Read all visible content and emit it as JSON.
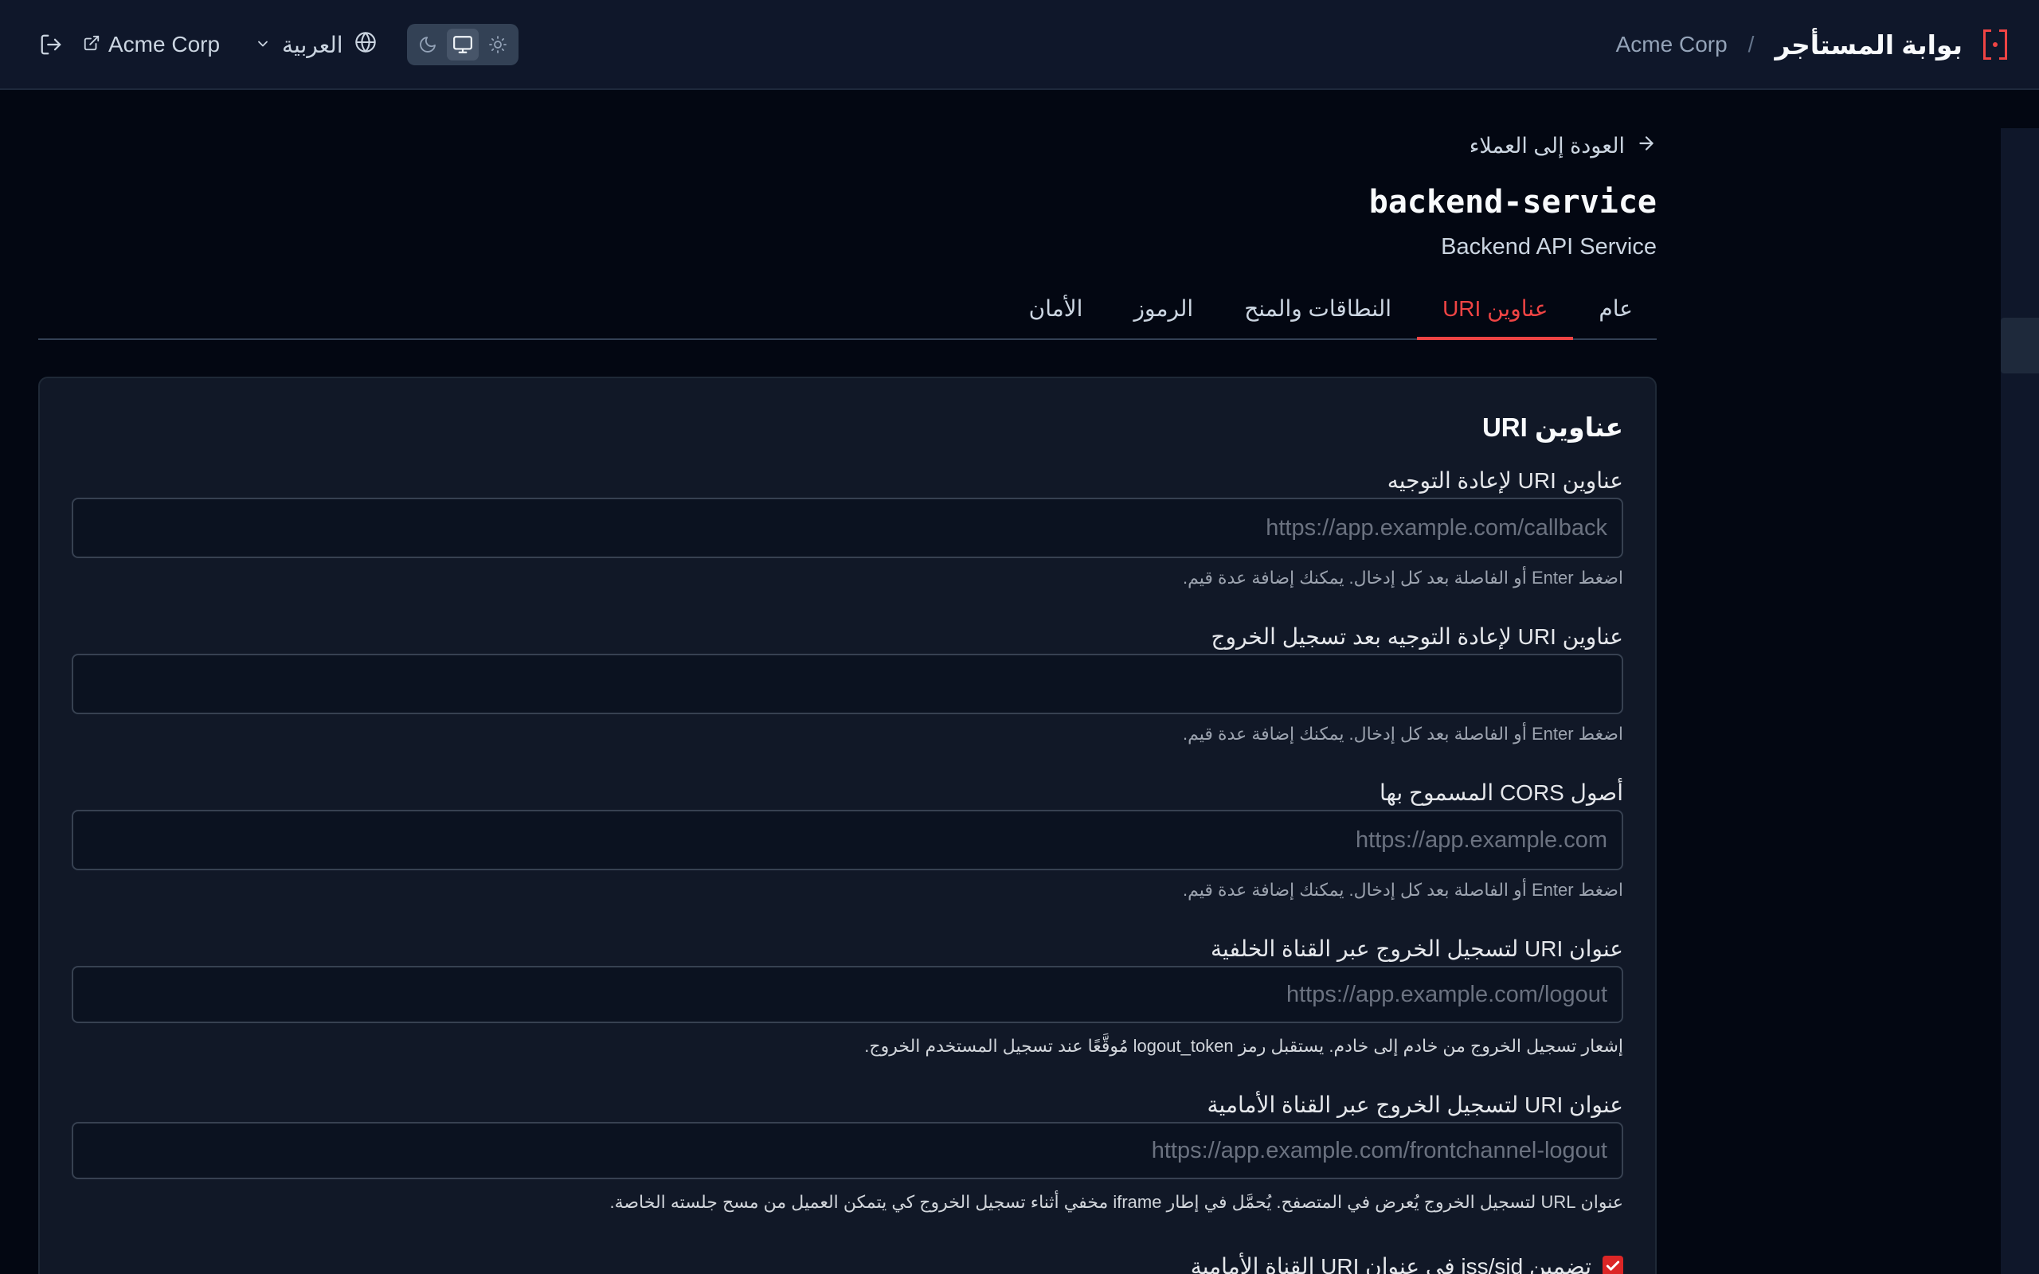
{
  "header": {
    "brand_title": "بوابة المستأجر",
    "separator": "/",
    "tenant": "Acme Corp",
    "tenant_link": "Acme Corp",
    "language": "العربية"
  },
  "back_link": "العودة إلى العملاء",
  "client": {
    "name": "backend-service",
    "description": "Backend API Service"
  },
  "tabs": [
    {
      "label": "عام",
      "active": false
    },
    {
      "label": "عناوين URI",
      "active": true
    },
    {
      "label": "النطاقات والمنح",
      "active": false
    },
    {
      "label": "الرموز",
      "active": false
    },
    {
      "label": "الأمان",
      "active": false
    }
  ],
  "card": {
    "title": "عناوين URI",
    "fields": [
      {
        "label": "عناوين URI لإعادة التوجيه",
        "value": "",
        "placeholder": "https://app.example.com/callback",
        "help": "اضغط Enter أو الفاصلة بعد كل إدخال. يمكنك إضافة عدة قيم."
      },
      {
        "label": "عناوين URI لإعادة التوجيه بعد تسجيل الخروج",
        "value": "",
        "placeholder": "",
        "help": "اضغط Enter أو الفاصلة بعد كل إدخال. يمكنك إضافة عدة قيم."
      },
      {
        "label": "أصول CORS المسموح بها",
        "value": "",
        "placeholder": "https://app.example.com",
        "help": "اضغط Enter أو الفاصلة بعد كل إدخال. يمكنك إضافة عدة قيم."
      },
      {
        "label": "عنوان URI لتسجيل الخروج عبر القناة الخلفية",
        "value": "",
        "placeholder": "https://app.example.com/logout",
        "help": "إشعار تسجيل الخروج من خادم إلى خادم. يستقبل رمز logout_token مُوقَّعًا عند تسجيل المستخدم الخروج."
      },
      {
        "label": "عنوان URI لتسجيل الخروج عبر القناة الأمامية",
        "value": "",
        "placeholder": "https://app.example.com/frontchannel-logout",
        "help": "عنوان URL لتسجيل الخروج يُعرض في المتصفح. يُحمَّل في إطار iframe مخفي أثناء تسجيل الخروج كي يتمكن العميل من مسح جلسته الخاصة."
      }
    ],
    "checkbox": {
      "label": "تضمين iss/sid في عنوان URI القناة الأمامية",
      "checked": true
    }
  },
  "colors": {
    "accent": "#ef4444",
    "background": "#030712",
    "header_bg": "#0f172a",
    "card_bg": "#111827"
  },
  "icons": {
    "logout": "logout-icon",
    "external_link": "external-link-icon",
    "chevron": "chevron-down-icon",
    "globe": "globe-icon",
    "moon": "moon-icon",
    "monitor": "monitor-icon",
    "sun": "sun-icon",
    "back_arrow": "arrow-right-icon"
  }
}
